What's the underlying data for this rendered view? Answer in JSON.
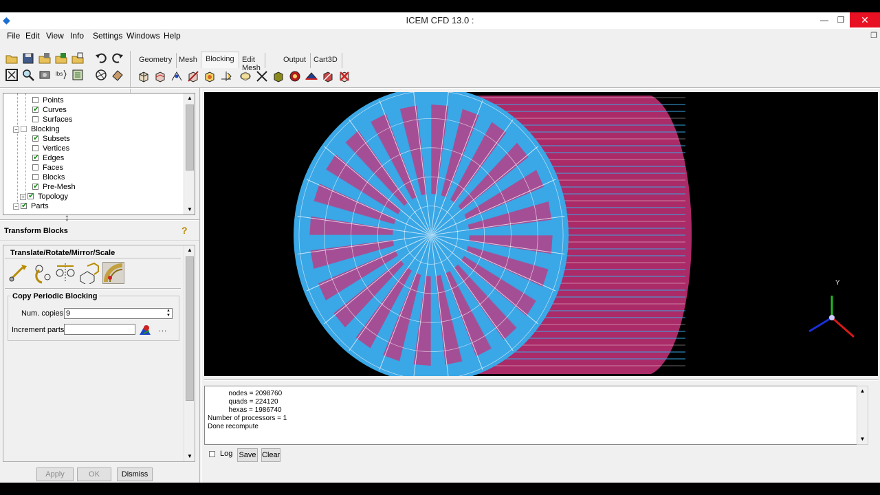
{
  "window": {
    "title": "ICEM CFD 13.0 :",
    "min_glyph": "—",
    "max_glyph": "❐",
    "close_glyph": "✕"
  },
  "menu": [
    "File",
    "Edit",
    "View",
    "Info",
    "Settings",
    "Windows",
    "Help"
  ],
  "tabs": [
    "Geometry",
    "Mesh",
    "Blocking",
    "Edit Mesh",
    "Output",
    "Cart3D"
  ],
  "active_tab": "Blocking",
  "tree": {
    "rows": [
      {
        "label": "Points",
        "checked": false,
        "level": 2,
        "expander": false
      },
      {
        "label": "Curves",
        "checked": true,
        "level": 2,
        "expander": false
      },
      {
        "label": "Surfaces",
        "checked": false,
        "level": 2,
        "expander": false
      },
      {
        "label": "Blocking",
        "checked": false,
        "level": 1,
        "expander": "−"
      },
      {
        "label": "Subsets",
        "checked": true,
        "level": 2,
        "expander": false
      },
      {
        "label": "Vertices",
        "checked": false,
        "level": 2,
        "expander": false
      },
      {
        "label": "Edges",
        "checked": true,
        "level": 2,
        "expander": false
      },
      {
        "label": "Faces",
        "checked": false,
        "level": 2,
        "expander": false
      },
      {
        "label": "Blocks",
        "checked": false,
        "level": 2,
        "expander": false
      },
      {
        "label": "Pre-Mesh",
        "checked": true,
        "level": 2,
        "expander": false
      },
      {
        "label": "Topology",
        "checked": true,
        "level": 2,
        "expander": "+"
      },
      {
        "label": "Parts",
        "checked": true,
        "level": 1,
        "expander": "−"
      }
    ]
  },
  "panel": {
    "title": "Transform Blocks",
    "section": "Translate/Rotate/Mirror/Scale",
    "group_title": "Copy Periodic Blocking",
    "num_copies_label": "Num. copies",
    "num_copies_value": "9",
    "increment_parts_label": "Increment parts",
    "increment_parts_value": "",
    "dots": "...",
    "help_glyph": "?"
  },
  "buttons": {
    "apply": "Apply",
    "ok": "OK",
    "dismiss": "Dismiss",
    "save": "Save",
    "clear": "Clear",
    "log": "Log"
  },
  "messages": [
    "           nodes = 2098760",
    "           quads = 224120",
    "           hexas = 1986740",
    "Number of processors = 1",
    "Done recompute"
  ],
  "axes": {
    "y_label": "Y"
  },
  "colors": {
    "mesh_blue": "#3aa7e6",
    "mesh_magenta": "#c8327a",
    "axis_green": "#22b822",
    "axis_red": "#d61a1a",
    "axis_blue": "#1a2fd6",
    "close_red": "#e81123"
  }
}
